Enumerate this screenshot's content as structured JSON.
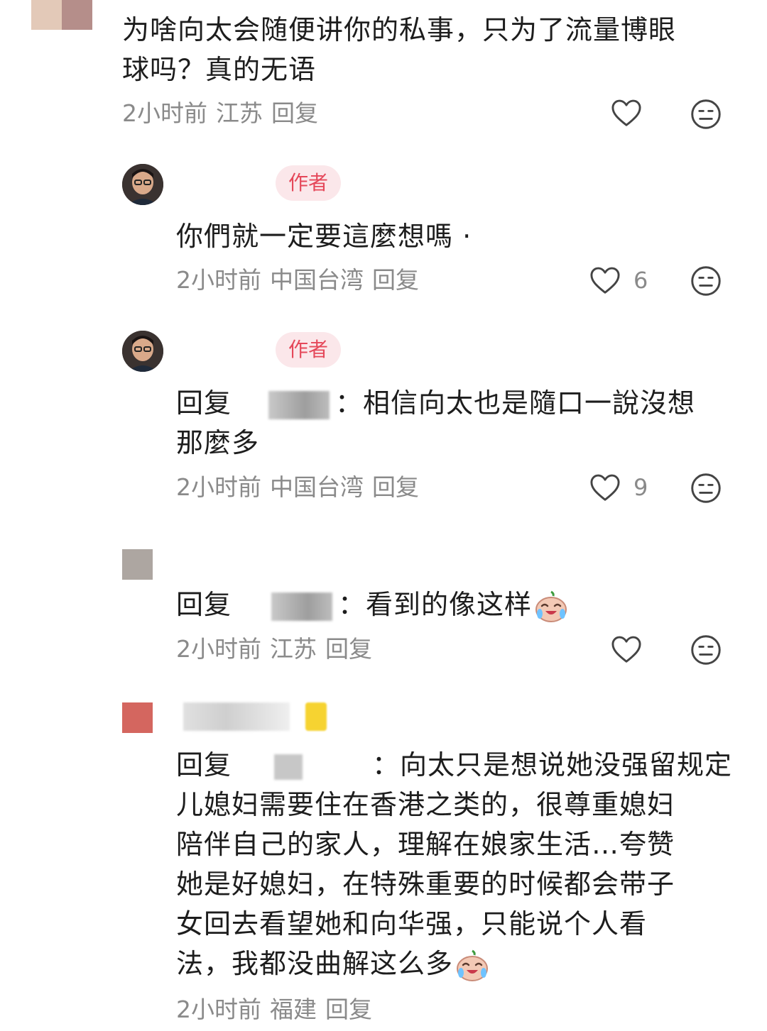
{
  "comments": [
    {
      "text_line1": "为啥向太会随便讲你的私事，只为了流量博眼",
      "text_line2": "球吗？真的无语",
      "time": "2小时前",
      "location": "江苏",
      "reply": "回复",
      "likes": ""
    },
    {
      "badge": "作者",
      "text_line1": "你們就一定要這麼想嗎 ·",
      "time": "2小时前",
      "location": "中国台湾",
      "reply": "回复",
      "likes": "6"
    },
    {
      "badge": "作者",
      "reply_prefix": "回复",
      "colon": "：",
      "text_line1": "相信向太也是隨口一說沒想",
      "text_line2": "那麼多",
      "time": "2小时前",
      "location": "中国台湾",
      "reply": "回复",
      "likes": "9"
    },
    {
      "reply_prefix": "回复",
      "colon": "：",
      "text_line1": "看到的像这样",
      "time": "2小时前",
      "location": "江苏",
      "reply": "回复",
      "likes": ""
    },
    {
      "reply_prefix": "回复",
      "colon": "：",
      "text_line1": "向太只是想说她没强留规定",
      "text_line2": "儿媳妇需要住在香港之类的，很尊重媳妇",
      "text_line3": "陪伴自己的家人，理解在娘家生活…夸赞",
      "text_line4": "她是好媳妇，在特殊重要的时候都会带子",
      "text_line5": "女回去看望她和向华强，只能说个人看",
      "text_line6": "法，我都没曲解这么多",
      "time": "2小时前",
      "location": "福建",
      "reply": "回复"
    }
  ],
  "colors": {
    "author_badge_bg": "#fbe7ea",
    "author_badge_text": "#e5485a",
    "meta_text": "#8a8a8a",
    "body_text": "#1d1d1d"
  },
  "icons": {
    "like": "heart-outline-icon",
    "dislike": "meh-face-icon",
    "emoji": "crying-laughing-emoji-icon"
  }
}
